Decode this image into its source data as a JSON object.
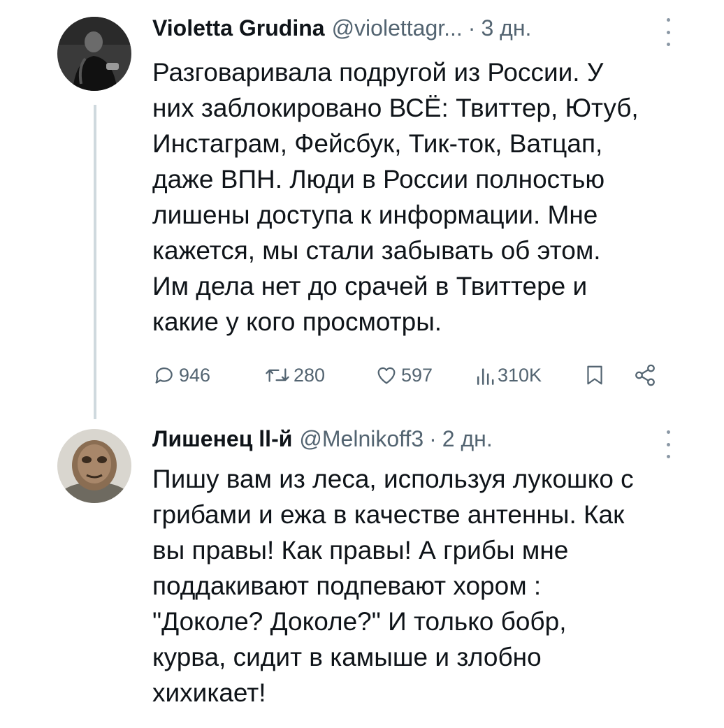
{
  "tweets": [
    {
      "author_name": "Violetta Grudina",
      "handle": "@violettagr...",
      "separator": "·",
      "time": "3 дн.",
      "lines": [
        "Разговаривала подругой из России. У",
        "них заблокировано ВСЁ: Твиттер, Ютуб,",
        "Инстаграм, Фейсбук, Тик-ток, Ватцап,",
        "даже ВПН. Люди в России полностью",
        "лишены доступа к информации. Мне",
        "кажется, мы стали забывать об этом.",
        "Им дела нет до срачей в Твиттере и",
        "какие у кого просмотры."
      ],
      "stats": {
        "replies": "946",
        "retweets": "280",
        "likes": "597",
        "views": "310K"
      }
    },
    {
      "author_name": "Лишенец ll-й",
      "handle": "@Melnikoff3",
      "separator": "·",
      "time": "2 дн.",
      "lines": [
        "Пишу вам из леса, используя лукошко с",
        "грибами и ежа в качестве антенны. Как",
        "вы правы! Как правы! А грибы мне",
        "поддакивают подпевают хором :",
        "\"Доколе? Доколе?\" И только бобр,",
        "курва, сидит в камыше и злобно",
        "хихикает!"
      ]
    }
  ],
  "icons": {
    "reply": "reply-icon",
    "retweet": "retweet-icon",
    "like": "heart-icon",
    "views": "views-icon",
    "bookmark": "bookmark-icon",
    "share": "share-icon",
    "more": "more-icon"
  },
  "colors": {
    "text": "#0f1419",
    "secondary": "#536471",
    "thread_line": "#cfd9de"
  }
}
